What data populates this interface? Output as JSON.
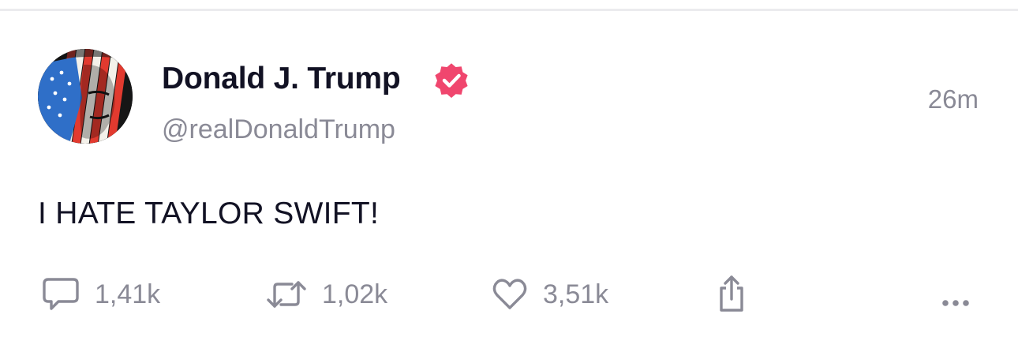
{
  "post": {
    "author": {
      "display_name": "Donald J. Trump",
      "handle": "@realDonaldTrump",
      "verified": true,
      "avatar_icon": "flag-portrait-avatar"
    },
    "timestamp": "26m",
    "text": "I HATE TAYLOR SWIFT!",
    "actions": {
      "reply": {
        "icon": "speech-bubble-icon",
        "count": "1,41k"
      },
      "repost": {
        "icon": "repost-arrows-icon",
        "count": "1,02k"
      },
      "like": {
        "icon": "heart-icon",
        "count": "3,51k"
      },
      "share": {
        "icon": "share-icon"
      },
      "more": {
        "icon": "ellipsis-icon"
      }
    }
  },
  "colors": {
    "text_primary": "#121224",
    "text_secondary": "#8a8a96",
    "verified_badge": "#f0466e",
    "divider": "#ebebee"
  }
}
